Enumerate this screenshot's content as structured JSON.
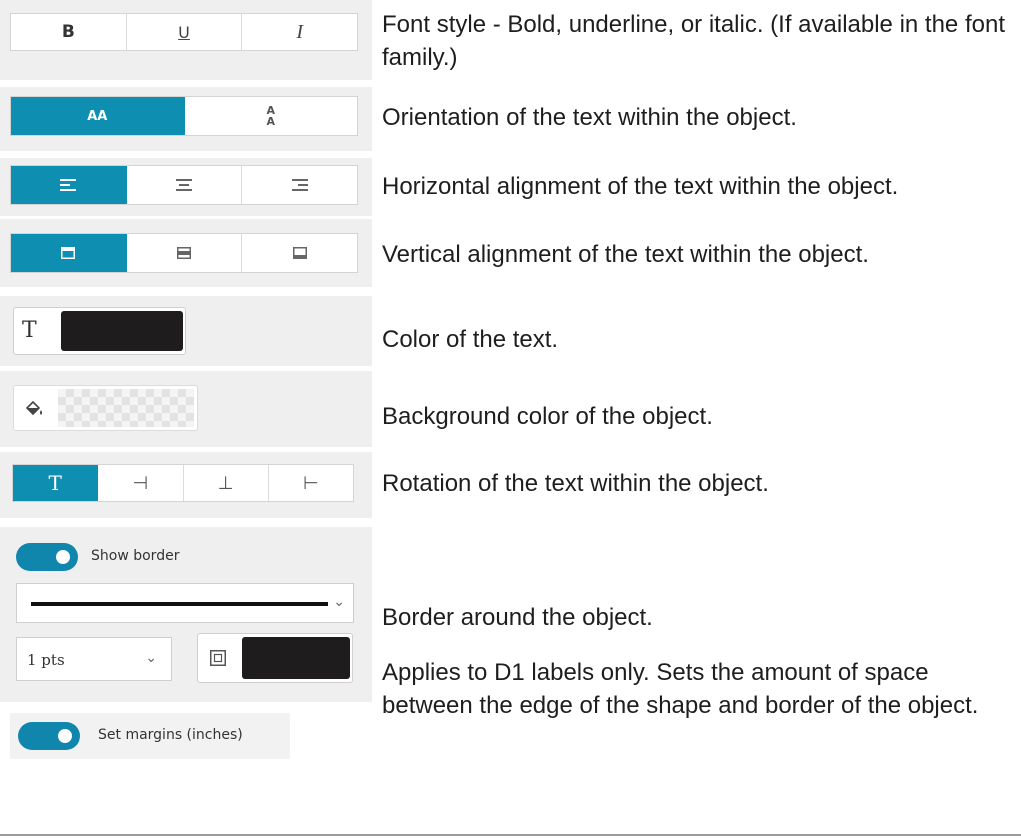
{
  "rows": {
    "font_style": {
      "buttons": [
        "B",
        "U",
        "I"
      ],
      "description": "Font style - Bold, underline, or italic. (If available in the font family.)"
    },
    "orientation": {
      "buttons": [
        "AA",
        "A\nA"
      ],
      "active_index": 0,
      "description": "Orientation of the text within the object."
    },
    "horizontal_alignment": {
      "icons": [
        "align-left-icon",
        "align-center-icon",
        "align-right-icon"
      ],
      "active_index": 0,
      "description": "Horizontal alignment of the text within the object."
    },
    "vertical_alignment": {
      "icons": [
        "align-top-icon",
        "align-middle-icon",
        "align-bottom-icon"
      ],
      "active_index": 0,
      "description": "Vertical alignment of the text within the object."
    },
    "text_color": {
      "icon_letter": "T",
      "color": "#1f1c1d",
      "description": "Color of the text."
    },
    "background_color": {
      "icon": "paint-bucket-icon",
      "color": "transparent",
      "description": "Background color of the object."
    },
    "rotation": {
      "buttons": [
        "T",
        "⊣",
        "⊥",
        "⊢"
      ],
      "active_index": 0,
      "description": "Rotation of the text within the object."
    },
    "border": {
      "toggle_label": "Show border",
      "toggle_on": true,
      "line_style": "solid",
      "width_value": "1 pts",
      "color": "#1f1c1d",
      "description": "Border around the object."
    },
    "margins": {
      "toggle_label": "Set margins (inches)",
      "toggle_on": true,
      "description": "Applies to D1 labels only. Sets the amount of space between the edge of the shape and border of the object."
    }
  },
  "colors": {
    "accent": "#0e8fb1",
    "swatch": "#1f1c1d",
    "pane": "#efefef"
  }
}
